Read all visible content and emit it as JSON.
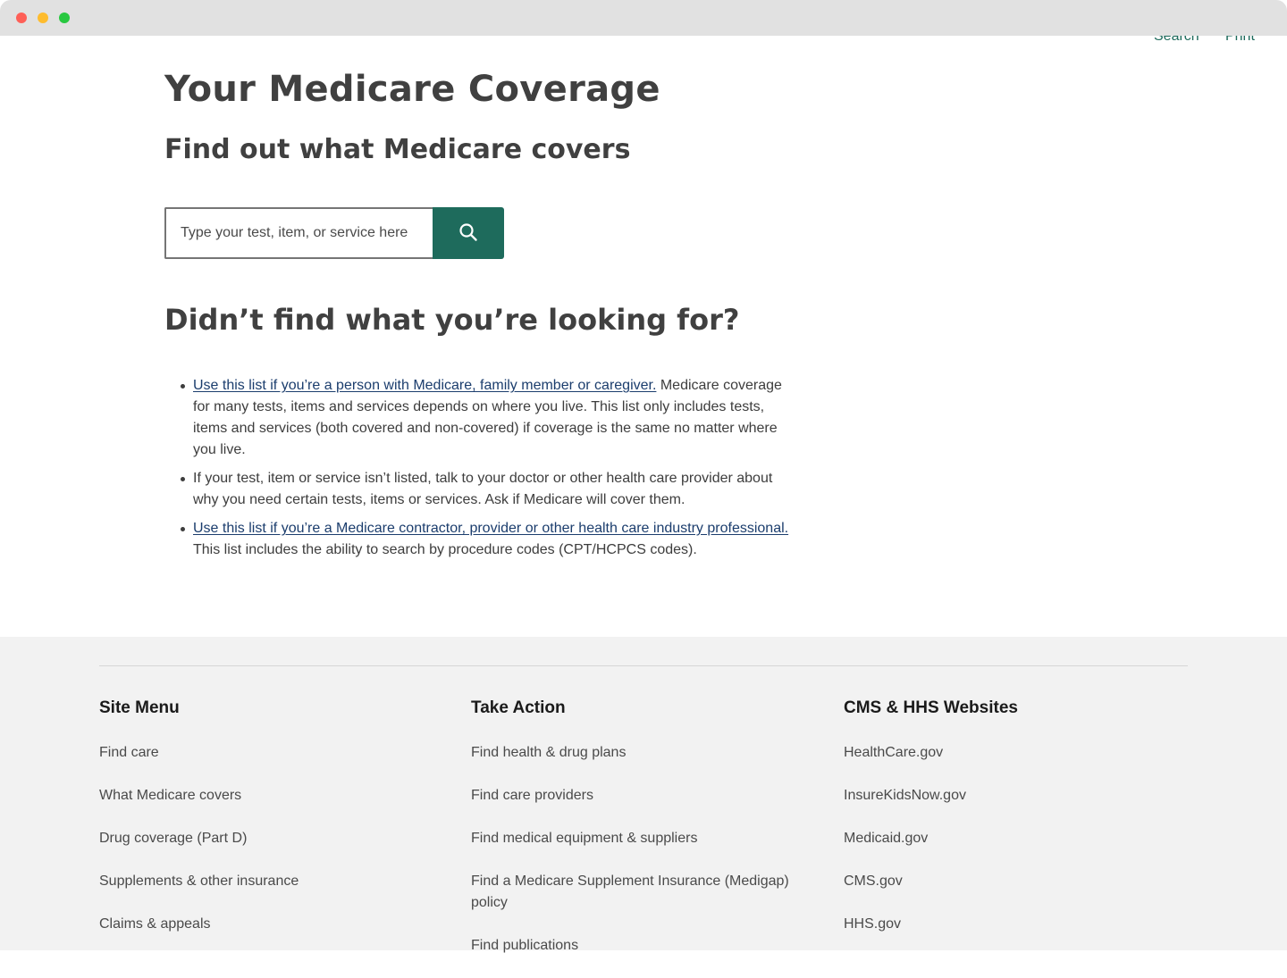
{
  "window": {
    "colors": {
      "close": "#fe5f57",
      "minimize": "#febc2e",
      "zoom": "#28c840"
    }
  },
  "utility_nav": {
    "search_label": "Search",
    "print_label": "Print"
  },
  "main": {
    "title": "Your Medicare Coverage",
    "subtitle": "Find out what Medicare covers",
    "search": {
      "placeholder": "Type your test, item, or service here",
      "value": "",
      "button_icon": "search-icon"
    },
    "section_heading": "Didn’t find what you’re looking for?",
    "items": [
      {
        "link": "Use this list if you’re a person with Medicare, family member or caregiver.",
        "text": " Medicare coverage for many tests, items and services depends on where you live. This list only includes tests, items and services (both covered and non-covered) if coverage is the same no matter where you live."
      },
      {
        "link": "",
        "text": "If your test, item or service isn’t listed, talk to your doctor or other health care provider about why you need certain tests, items or services. Ask if Medicare will cover them."
      },
      {
        "link": "Use this list if you’re a Medicare contractor, provider or other health care industry professional.",
        "text": " This list includes the ability to search by procedure codes (CPT/HCPCS codes)."
      }
    ]
  },
  "footer": {
    "columns": [
      {
        "heading": "Site Menu",
        "links": [
          "Find care",
          "What Medicare covers",
          "Drug coverage (Part D)",
          "Supplements & other insurance",
          "Claims & appeals"
        ]
      },
      {
        "heading": "Take Action",
        "links": [
          "Find health & drug plans",
          "Find care providers",
          "Find medical equipment & suppliers",
          "Find a Medicare Supplement Insurance (Medigap) policy",
          "Find publications"
        ]
      },
      {
        "heading": "CMS & HHS Websites",
        "links": [
          "HealthCare.gov",
          "InsureKidsNow.gov",
          "Medicaid.gov",
          "CMS.gov",
          "HHS.gov"
        ]
      }
    ]
  },
  "colors": {
    "accent": "#1e6b5c",
    "link": "#1b3d6d",
    "heading": "#404040",
    "footer_bg": "#f2f2f2"
  }
}
